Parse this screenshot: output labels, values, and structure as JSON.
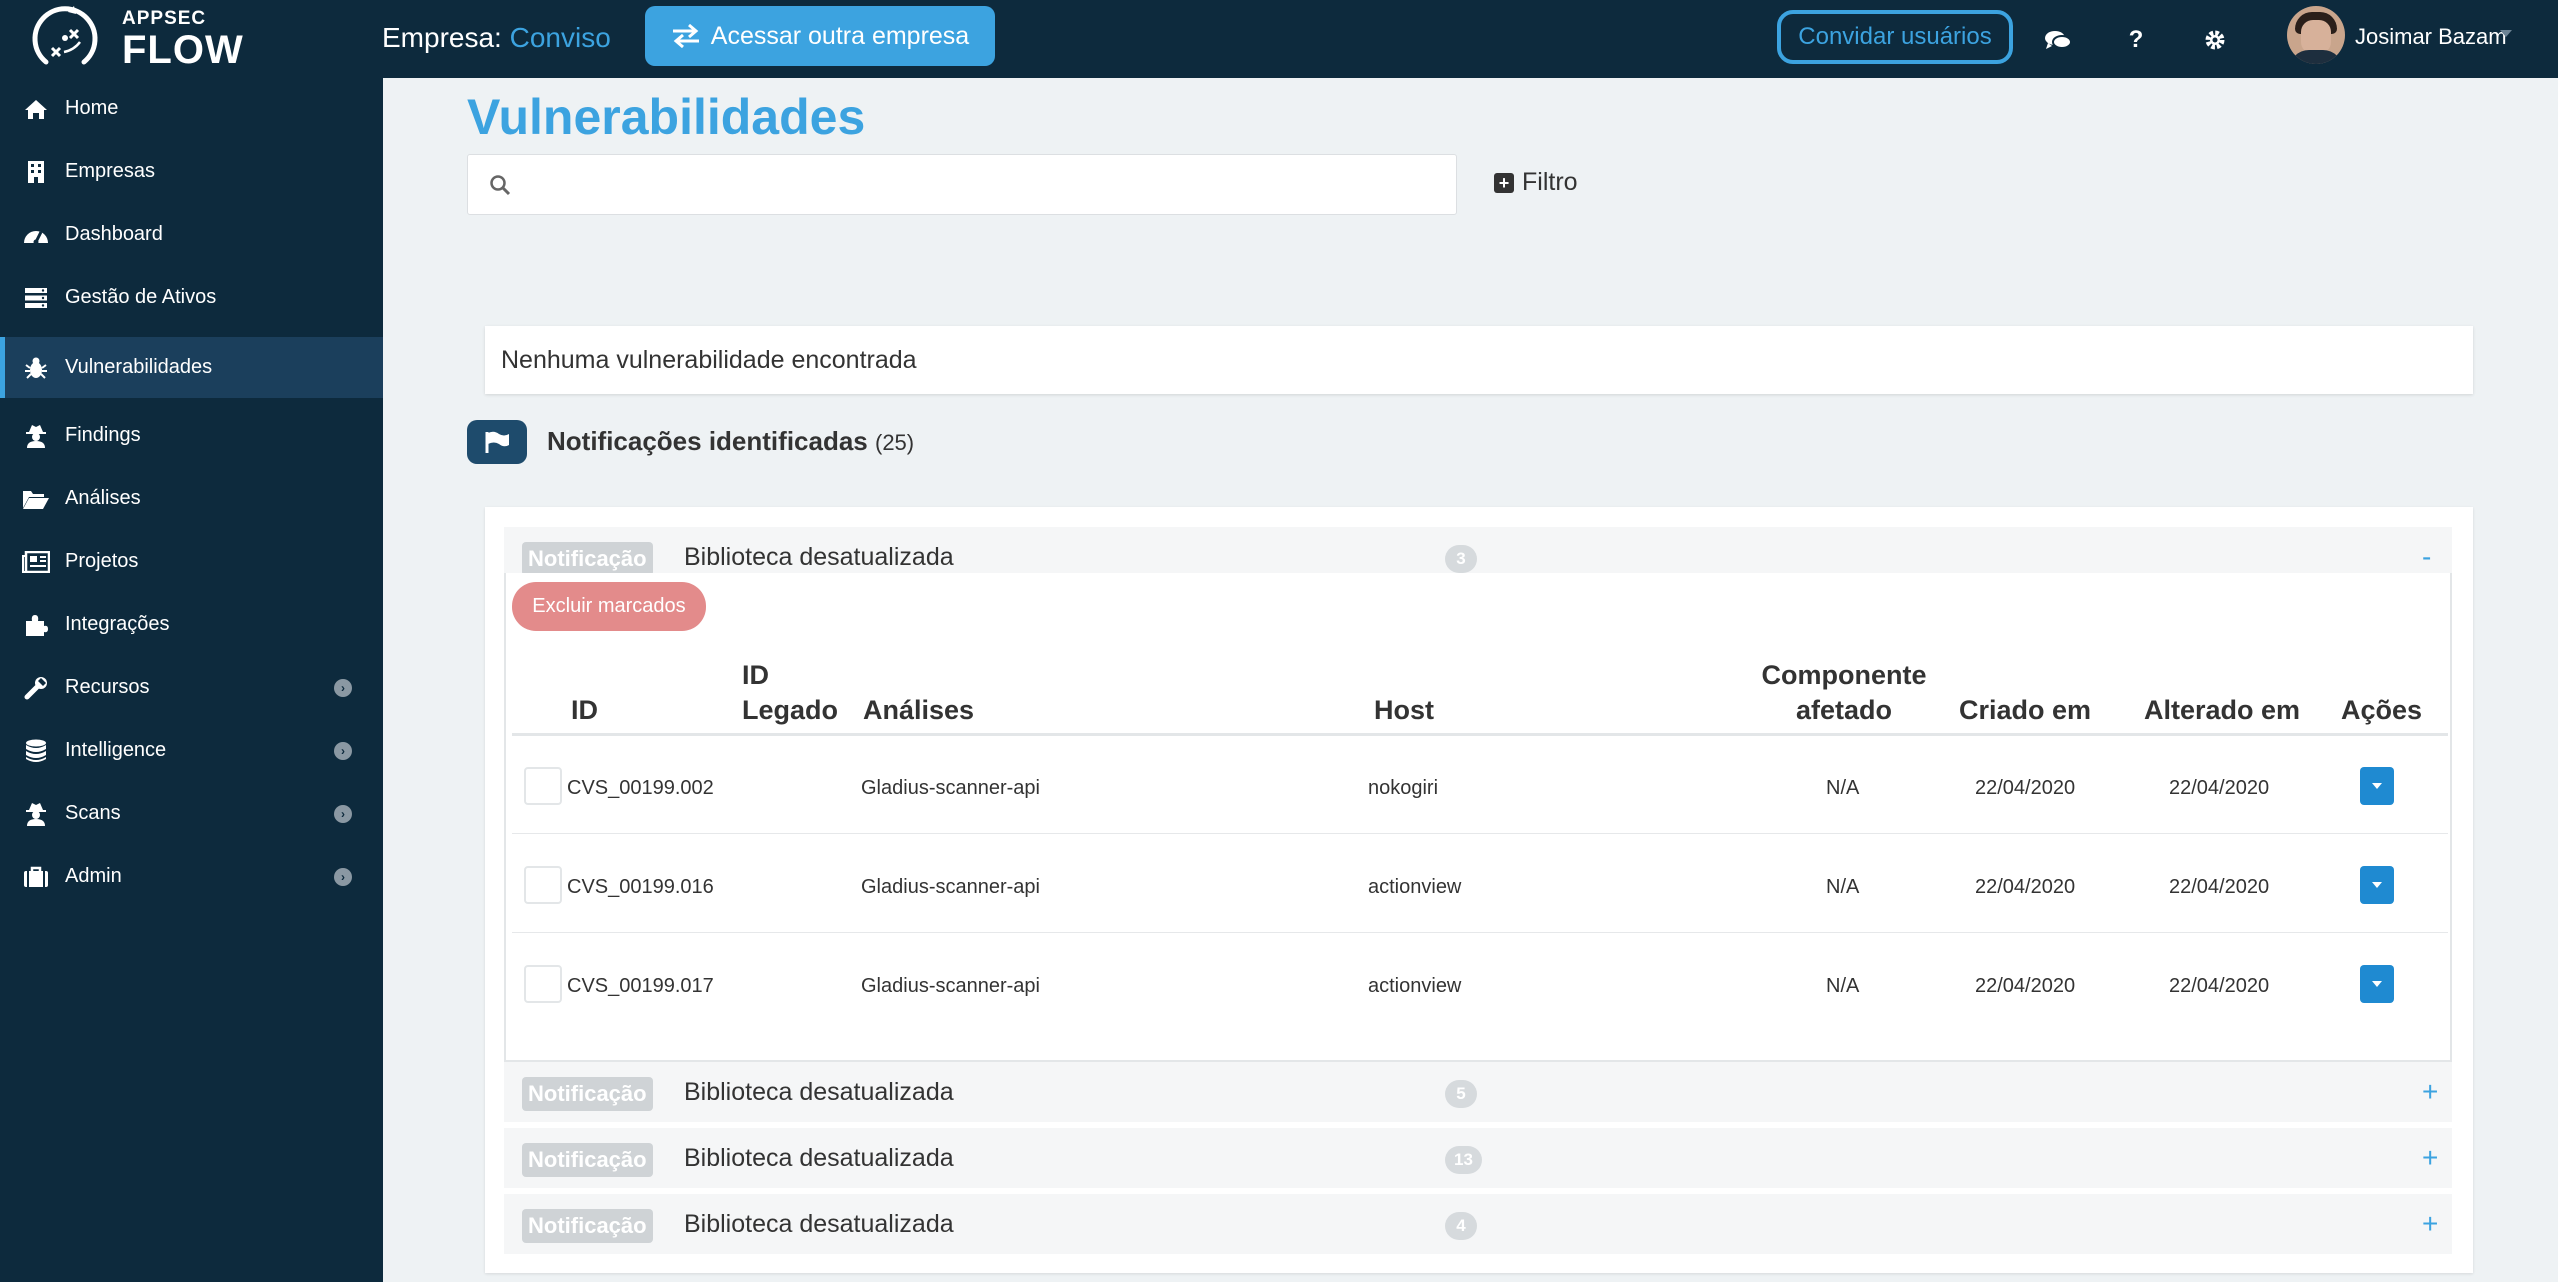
{
  "header": {
    "logo_line1": "APPSEC",
    "logo_line2": "FLOW",
    "company_label": "Empresa:",
    "company_name": "Conviso",
    "switch_button": "Acessar outra empresa",
    "invite_button": "Convidar usuários",
    "user_name": "Josimar Bazam",
    "icons": [
      "chat-icon",
      "help-icon",
      "settings-icon"
    ]
  },
  "sidebar": {
    "items": [
      {
        "label": "Home",
        "icon": "home-icon"
      },
      {
        "label": "Empresas",
        "icon": "building-icon"
      },
      {
        "label": "Dashboard",
        "icon": "dashboard-icon"
      },
      {
        "label": "Gestão de Ativos",
        "icon": "server-icon"
      },
      {
        "label": "Vulnerabilidades",
        "icon": "bug-icon",
        "active": true
      },
      {
        "label": "Findings",
        "icon": "spy-icon"
      },
      {
        "label": "Análises",
        "icon": "folder-icon"
      },
      {
        "label": "Projetos",
        "icon": "newspaper-icon"
      },
      {
        "label": "Integrações",
        "icon": "puzzle-icon"
      },
      {
        "label": "Recursos",
        "icon": "wrench-icon",
        "expandable": true
      },
      {
        "label": "Intelligence",
        "icon": "database-icon",
        "expandable": true
      },
      {
        "label": "Scans",
        "icon": "spy-icon",
        "expandable": true
      },
      {
        "label": "Admin",
        "icon": "briefcase-icon",
        "expandable": true
      }
    ]
  },
  "main": {
    "title": "Vulnerabilidades",
    "search": {
      "value": "",
      "placeholder": ""
    },
    "filter_label": "Filtro",
    "empty_message": "Nenhuma vulnerabilidade encontrada",
    "notifications": {
      "title": "Notificações identificadas",
      "count": "(25)",
      "delete_button": "Excluir marcados",
      "columns": {
        "id": "ID",
        "legacy_id_1": "ID",
        "legacy_id_2": "Legado",
        "analyses": "Análises",
        "host": "Host",
        "component_1": "Componente",
        "component_2": "afetado",
        "created": "Criado em",
        "updated": "Alterado em",
        "actions": "Ações"
      },
      "groups": [
        {
          "tag": "Notificação",
          "title": "Biblioteca desatualizada",
          "count": "3",
          "toggle": "-",
          "expanded": true,
          "rows": [
            {
              "id": "CVS_00199.002",
              "legacy": "",
              "analysis": "Gladius-scanner-api",
              "host": "nokogiri",
              "component": "N/A",
              "created": "22/04/2020",
              "updated": "22/04/2020"
            },
            {
              "id": "CVS_00199.016",
              "legacy": "",
              "analysis": "Gladius-scanner-api",
              "host": "actionview",
              "component": "N/A",
              "created": "22/04/2020",
              "updated": "22/04/2020"
            },
            {
              "id": "CVS_00199.017",
              "legacy": "",
              "analysis": "Gladius-scanner-api",
              "host": "actionview",
              "component": "N/A",
              "created": "22/04/2020",
              "updated": "22/04/2020"
            }
          ]
        },
        {
          "tag": "Notificação",
          "title": "Biblioteca desatualizada",
          "count": "5",
          "toggle": "+"
        },
        {
          "tag": "Notificação",
          "title": "Biblioteca desatualizada",
          "count": "13",
          "toggle": "+"
        },
        {
          "tag": "Notificação",
          "title": "Biblioteca desatualizada",
          "count": "4",
          "toggle": "+"
        }
      ]
    }
  },
  "colors": {
    "nav_bg": "#0d2a3d",
    "accent": "#3ca3e0",
    "danger_soft": "#e38b8b",
    "action_blue": "#1f8ad1"
  }
}
